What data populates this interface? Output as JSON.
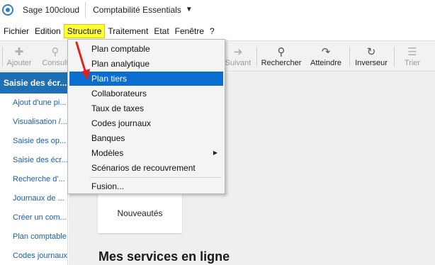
{
  "app": {
    "name": "Sage 100cloud",
    "module": "Comptabilité Essentials"
  },
  "menubar": {
    "items": [
      "Fichier",
      "Edition",
      "Structure",
      "Traitement",
      "Etat",
      "Fenêtre",
      "?"
    ],
    "active": "Structure"
  },
  "toolbar": {
    "buttons": [
      {
        "label": "Ajouter",
        "icon": "plus-icon",
        "enabled": false
      },
      {
        "label": "Consult",
        "icon": "search-icon",
        "enabled": false
      },
      {
        "label": "Suivant",
        "icon": "arrow-right-icon",
        "enabled": false
      },
      {
        "label": "Rechercher",
        "icon": "search-icon",
        "enabled": true
      },
      {
        "label": "Atteindre",
        "icon": "redo-icon",
        "enabled": true
      },
      {
        "label": "Inverseur",
        "icon": "refresh-icon",
        "enabled": true
      },
      {
        "label": "Trier",
        "icon": "sort-icon",
        "enabled": false
      }
    ]
  },
  "sidebar": {
    "header": "Saisie des écr...",
    "items": [
      "Ajout d'une pi...",
      "Visualisation /...",
      "Saisie des op...",
      "Saisie des écr...",
      "Recherche d'...",
      "Journaux de ...",
      "Créer un com...",
      "Plan comptable",
      "Codes journaux"
    ]
  },
  "dropdown": {
    "items": [
      "Plan comptable",
      "Plan analytique",
      "Plan tiers",
      "Collaborateurs",
      "Taux de taxes",
      "Codes journaux",
      "Banques",
      "Modèles",
      "Scénarios de recouvrement",
      "Fusion..."
    ],
    "selected": "Plan tiers",
    "submenu_item": "Modèles",
    "submenu_arrow": "▶"
  },
  "main": {
    "news_card": "Nouveautés",
    "services_title": "Mes services en ligne"
  },
  "colors": {
    "accent": "#0a6ed1",
    "sidebar_header": "#1f6fb5",
    "highlight": "#ffff3a",
    "annotation": "#e02020"
  }
}
